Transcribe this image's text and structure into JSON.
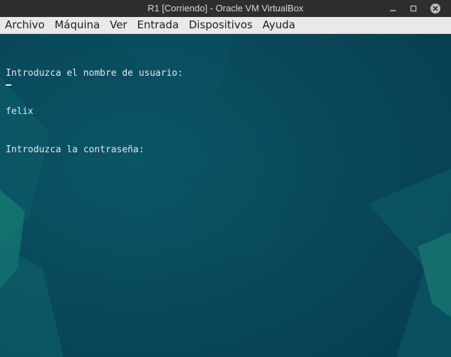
{
  "window": {
    "title": "R1 [Corriendo] - Oracle VM VirtualBox",
    "controls": [
      "minimize-icon",
      "maximize-icon",
      "close-icon"
    ]
  },
  "menu": {
    "items": [
      "Archivo",
      "Máquina",
      "Ver",
      "Entrada",
      "Dispositivos",
      "Ayuda"
    ]
  },
  "console": {
    "lines": [
      "Introduzca el nombre de usuario:",
      "felix",
      "Introduzca la contraseña:"
    ]
  },
  "colors": {
    "screen_bg": "#08485c",
    "accent_teal": "#1f8a7a",
    "text": "#e6e6e6"
  }
}
